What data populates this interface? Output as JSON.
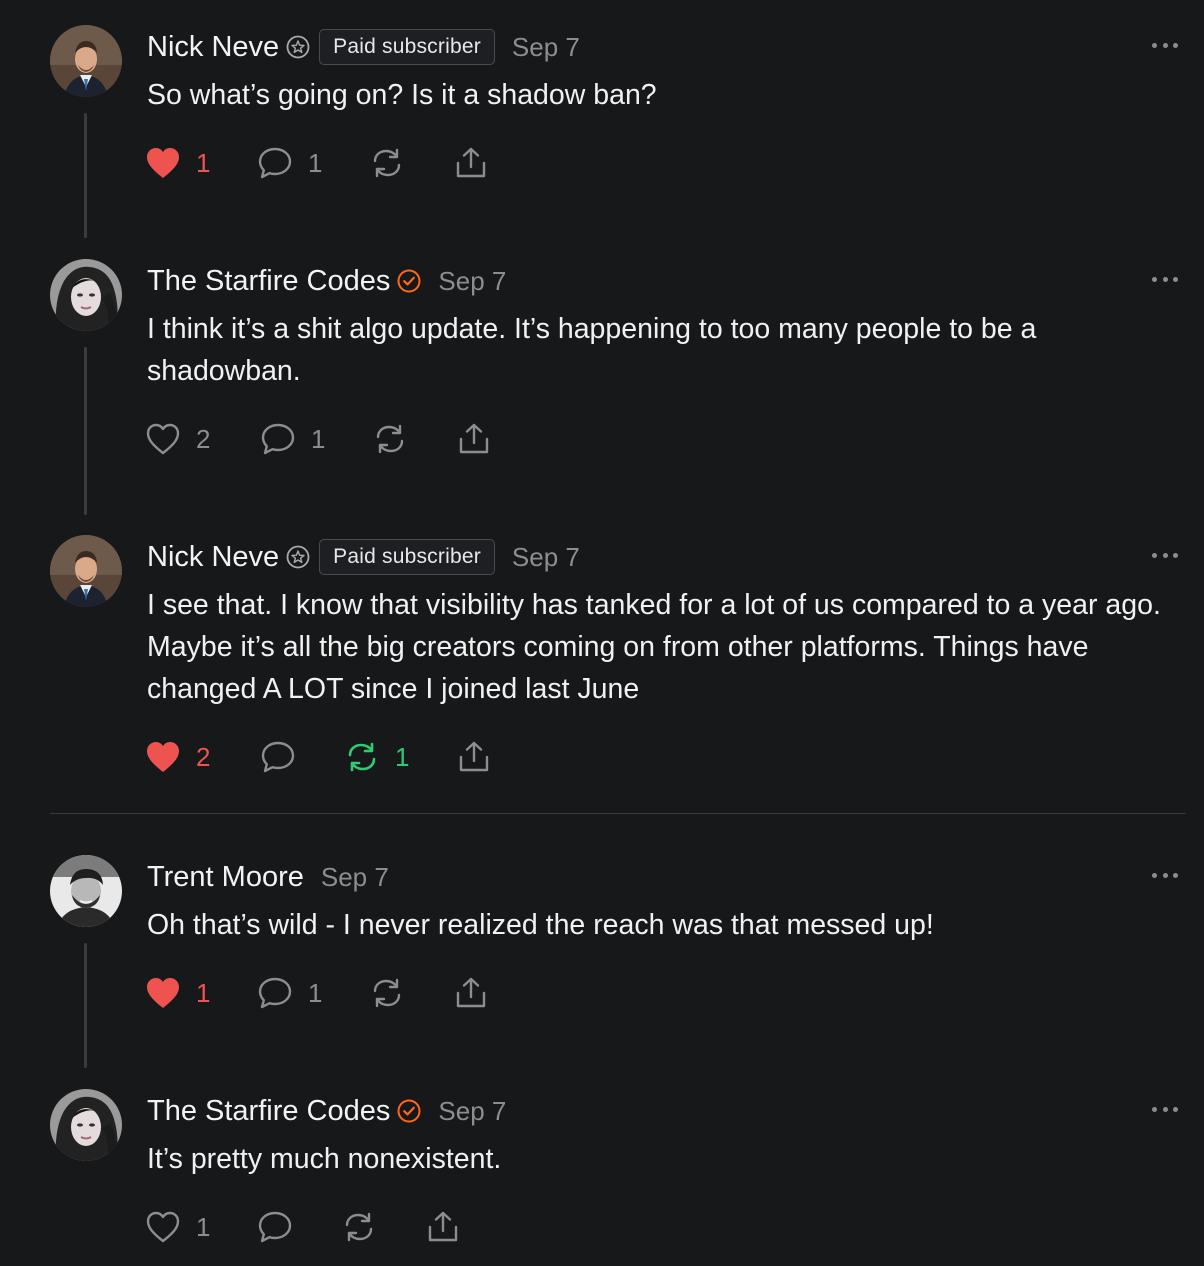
{
  "comments": [
    {
      "author": "Nick Neve",
      "author_badge": "paid-subscriber-icon",
      "badge_label": "Paid subscriber",
      "date": "Sep 7",
      "text": "So what’s going on? Is it a shadow ban?",
      "likes": "1",
      "liked": true,
      "replies": "1",
      "restacks": "",
      "restacked": false
    },
    {
      "author": "The Starfire Codes",
      "author_badge": "verified-check-icon",
      "badge_label": "",
      "date": "Sep 7",
      "text": "I think it’s a shit algo update. It’s happening to too many people to be a shadowban.",
      "likes": "2",
      "liked": false,
      "replies": "1",
      "restacks": "",
      "restacked": false
    },
    {
      "author": "Nick Neve",
      "author_badge": "paid-subscriber-icon",
      "badge_label": "Paid subscriber",
      "date": "Sep 7",
      "text": "I see that. I know that visibility has tanked for a lot of us compared to a year ago. Maybe it’s all the big creators coming on from other platforms. Things have changed A LOT since I joined last June",
      "likes": "2",
      "liked": true,
      "replies": "",
      "restacks": "1",
      "restacked": true
    },
    {
      "author": "Trent Moore",
      "author_badge": "",
      "badge_label": "",
      "date": "Sep 7",
      "text": "Oh that’s wild - I never realized the reach was that messed up!",
      "likes": "1",
      "liked": true,
      "replies": "1",
      "restacks": "",
      "restacked": false
    },
    {
      "author": "The Starfire Codes",
      "author_badge": "verified-check-icon",
      "badge_label": "",
      "date": "Sep 7",
      "text": "It’s pretty much nonexistent.",
      "likes": "1",
      "liked": false,
      "replies": "",
      "restacks": "",
      "restacked": false
    }
  ],
  "colors": {
    "background": "#17181a",
    "like_active": "#ef5350",
    "restack_active": "#2ecc71",
    "verified": "#ff6719",
    "muted": "#8c8d91"
  }
}
